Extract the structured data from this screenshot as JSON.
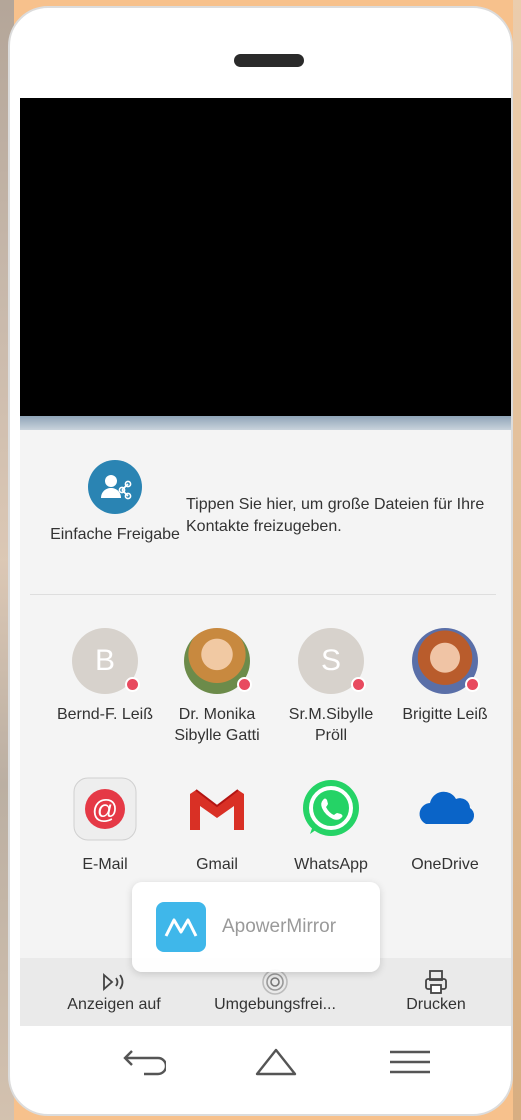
{
  "simple_share": {
    "label": "Einfache Freigabe",
    "description": "Tippen Sie hier, um große Dateien für Ihre Kontakte freizugeben."
  },
  "contacts": [
    {
      "name": "Bernd-F. Leiß",
      "initial": "B"
    },
    {
      "name": "Dr. Monika Sibylle Gatti"
    },
    {
      "name": "Sr.M.Sibylle Pröll",
      "initial": "S"
    },
    {
      "name": "Brigitte Leiß"
    }
  ],
  "apps": [
    {
      "name": "E-Mail",
      "icon": "email-icon"
    },
    {
      "name": "Gmail",
      "icon": "gmail-icon"
    },
    {
      "name": "WhatsApp",
      "icon": "whatsapp-icon"
    },
    {
      "name": "OneDrive",
      "icon": "onedrive-icon"
    }
  ],
  "actions": [
    {
      "label": "Anzeigen auf",
      "icon": "cast-icon"
    },
    {
      "label": "Umgebungsfrei...",
      "icon": "nearby-share-icon"
    },
    {
      "label": "Drucken",
      "icon": "print-icon"
    }
  ],
  "toast": {
    "text": "ApowerMirror"
  },
  "nav": {
    "back": "back-icon",
    "home": "home-icon",
    "menu": "menu-icon"
  },
  "colors": {
    "accent_blue": "#2a84b3",
    "badge_red": "#e84a5f",
    "whatsapp_green": "#25d366",
    "gmail_red": "#d93025",
    "onedrive_blue": "#0a64c8",
    "background_orange": "#f7c18c"
  }
}
